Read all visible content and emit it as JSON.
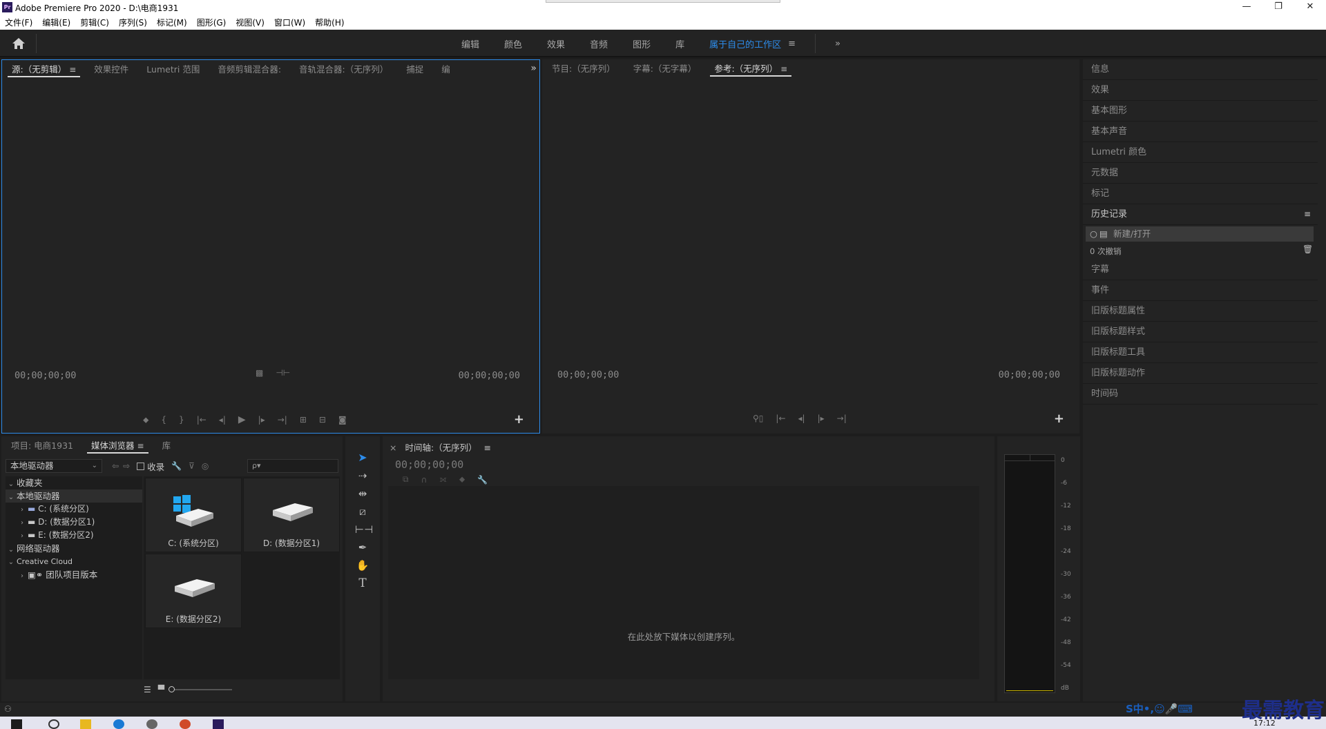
{
  "window": {
    "title": "Adobe Premiere Pro 2020 - D:\\电商1931",
    "app_icon": "Pr",
    "minimize": "—",
    "restore": "❐",
    "close": "✕"
  },
  "menu": [
    "文件(F)",
    "编辑(E)",
    "剪辑(C)",
    "序列(S)",
    "标记(M)",
    "图形(G)",
    "视图(V)",
    "窗口(W)",
    "帮助(H)"
  ],
  "workspaces": {
    "tabs": [
      "编辑",
      "颜色",
      "效果",
      "音频",
      "图形",
      "库"
    ],
    "active": "属于自己的工作区",
    "menu": "≡",
    "more": "»"
  },
  "source_panel": {
    "tabs": [
      "源:（无剪辑）",
      "效果控件",
      "Lumetri 范围",
      "音频剪辑混合器:",
      "音轨混合器:（无序列）",
      "捕捉",
      "编"
    ],
    "active_index": 0,
    "menu": "≡",
    "overflow": "»",
    "tc_left": "00;00;00;00",
    "tc_right": "00;00;00;00"
  },
  "program_panel": {
    "tabs": [
      "节目:（无序列）",
      "字幕:（无字幕）",
      "参考:（无序列）"
    ],
    "active_index": 2,
    "menu": "≡",
    "tc_left": "00;00;00;00",
    "tc_right": "00;00;00;00"
  },
  "right_panel": {
    "items_top": [
      "信息",
      "效果",
      "基本图形",
      "基本声音",
      "Lumetri 颜色",
      "元数据",
      "标记"
    ],
    "history_title": "历史记录",
    "history_menu": "≡",
    "history_entry": "新建/打开",
    "undo_count": "0 次撤销",
    "items_bottom": [
      "字幕",
      "事件",
      "旧版标题属性",
      "旧版标题样式",
      "旧版标题工具",
      "旧版标题动作",
      "时间码"
    ]
  },
  "project_panel": {
    "tabs": [
      "项目: 电商1931",
      "媒体浏览器",
      "库"
    ],
    "active_index": 1,
    "menu": "≡",
    "dropdown_value": "本地驱动器",
    "favorite_label": "收录",
    "search_placeholder": "ρ▾",
    "tree": [
      {
        "label": "收藏夹",
        "level": 0,
        "arrow": "⌄"
      },
      {
        "label": "本地驱动器",
        "level": 0,
        "arrow": "⌄",
        "selected": true
      },
      {
        "label": "C: (系统分区)",
        "level": 1,
        "arrow": "›"
      },
      {
        "label": "D: (数据分区1)",
        "level": 1,
        "arrow": "›"
      },
      {
        "label": "E: (数据分区2)",
        "level": 1,
        "arrow": "›"
      },
      {
        "label": "网络驱动器",
        "level": 0,
        "arrow": "⌄"
      },
      {
        "label": "Creative Cloud",
        "level": 0,
        "arrow": "⌄"
      },
      {
        "label": "团队项目版本",
        "level": 1,
        "arrow": "›"
      }
    ],
    "thumbs": [
      "C: (系统分区)",
      "D: (数据分区1)",
      "E: (数据分区2)"
    ]
  },
  "timeline_panel": {
    "close": "×",
    "title": "时间轴:（无序列）",
    "menu": "≡",
    "timecode": "00;00;00;00",
    "empty_hint": "在此处放下媒体以创建序列。"
  },
  "meters": {
    "scale": [
      "0",
      "-6",
      "-12",
      "-18",
      "-24",
      "-30",
      "-36",
      "-42",
      "-48",
      "-54",
      "dB"
    ]
  },
  "taskbar": {
    "clock": "17:12"
  },
  "overlay": {
    "watermark": "最需教育",
    "ime": "S中•,☺🎤⌨"
  },
  "colors": {
    "accent": "#2d8ceb",
    "panel": "#232323",
    "background": "#1d1d1d"
  }
}
